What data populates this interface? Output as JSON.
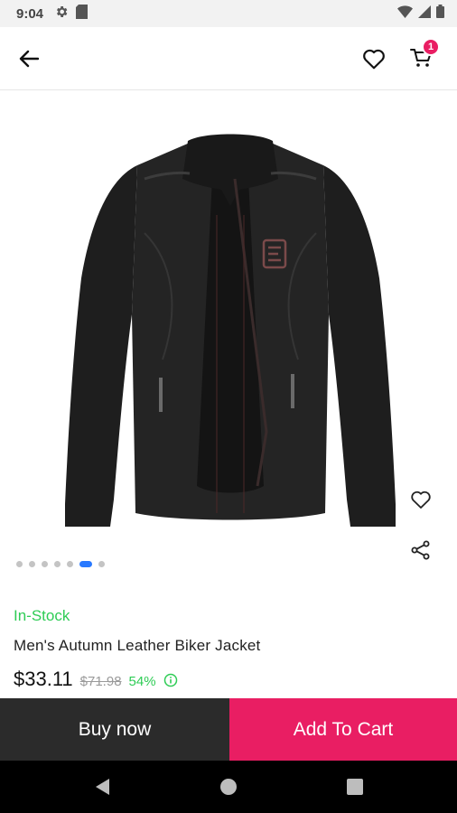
{
  "status_bar": {
    "time": "9:04",
    "icons": [
      "settings-icon",
      "sd-card-icon",
      "wifi-icon",
      "signal-icon",
      "battery-icon"
    ]
  },
  "app_bar": {
    "icons": [
      "back-arrow-icon",
      "heart-outline-icon",
      "cart-icon"
    ],
    "cart_count": "1"
  },
  "product": {
    "image": "black-leather-jacket",
    "carousel": {
      "total": 7,
      "active_index": 5
    },
    "stock_status": "In-Stock",
    "title": "Men's Autumn Leather Biker Jacket",
    "price": "$33.11",
    "original_price": "$71.98",
    "discount": "54%"
  },
  "actions": {
    "buy_now": "Buy now",
    "add_to_cart": "Add To Cart"
  },
  "colors": {
    "accent": "#e91e63",
    "in_stock": "#2ecc55",
    "dot_active": "#2979ff",
    "buy_now_bg": "#2b2b2b"
  }
}
